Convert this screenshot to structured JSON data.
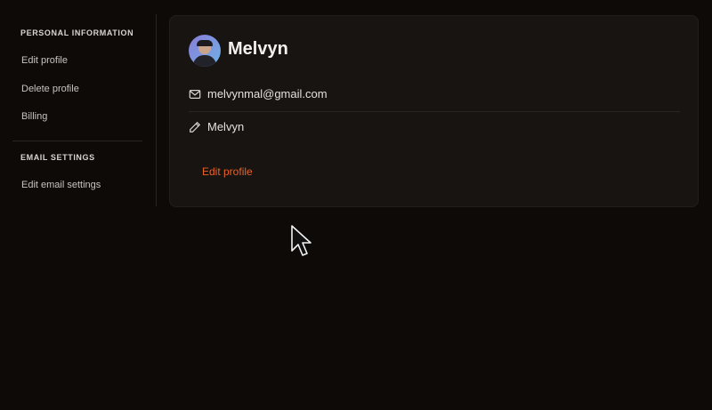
{
  "sidebar": {
    "personal_section": "PERSONAL INFORMATION",
    "items": [
      {
        "label": "Edit profile"
      },
      {
        "label": "Delete profile"
      },
      {
        "label": "Billing"
      }
    ],
    "email_section": "EMAIL SETTINGS",
    "email_items": [
      {
        "label": "Edit email settings"
      }
    ]
  },
  "profile": {
    "name": "Melvyn",
    "email": "melvynmal@gmail.com",
    "display_name": "Melvyn",
    "edit_label": "Edit profile"
  },
  "colors": {
    "background": "#0d0a08",
    "card": "#181412",
    "accent": "#e8632a"
  },
  "icons": {
    "email": "mail-icon",
    "name": "pencil-icon",
    "cursor": "mouse-cursor-icon"
  }
}
